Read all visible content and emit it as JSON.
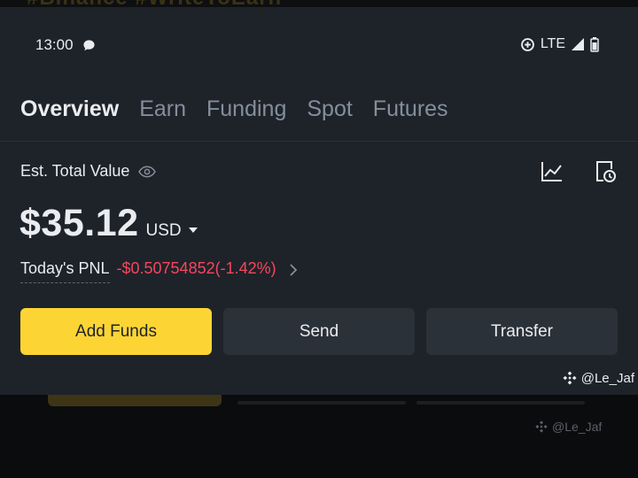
{
  "background_text": "#Binance #WriteToEarn",
  "status_bar": {
    "time": "13:00",
    "network": "LTE"
  },
  "tabs": [
    {
      "label": "Overview",
      "active": true
    },
    {
      "label": "Earn",
      "active": false
    },
    {
      "label": "Funding",
      "active": false
    },
    {
      "label": "Spot",
      "active": false
    },
    {
      "label": "Futures",
      "active": false
    }
  ],
  "balance": {
    "label": "Est. Total Value",
    "amount": "$35.12",
    "currency": "USD"
  },
  "pnl": {
    "label": "Today's PNL",
    "value": "-$0.50754852(-1.42%)"
  },
  "actions": {
    "add_funds": "Add Funds",
    "send": "Send",
    "transfer": "Transfer"
  },
  "watermark": "@Le_Jaf",
  "colors": {
    "background": "#1e2329",
    "accent": "#fcd535",
    "negative": "#f6465d",
    "muted_text": "#848e9c"
  }
}
